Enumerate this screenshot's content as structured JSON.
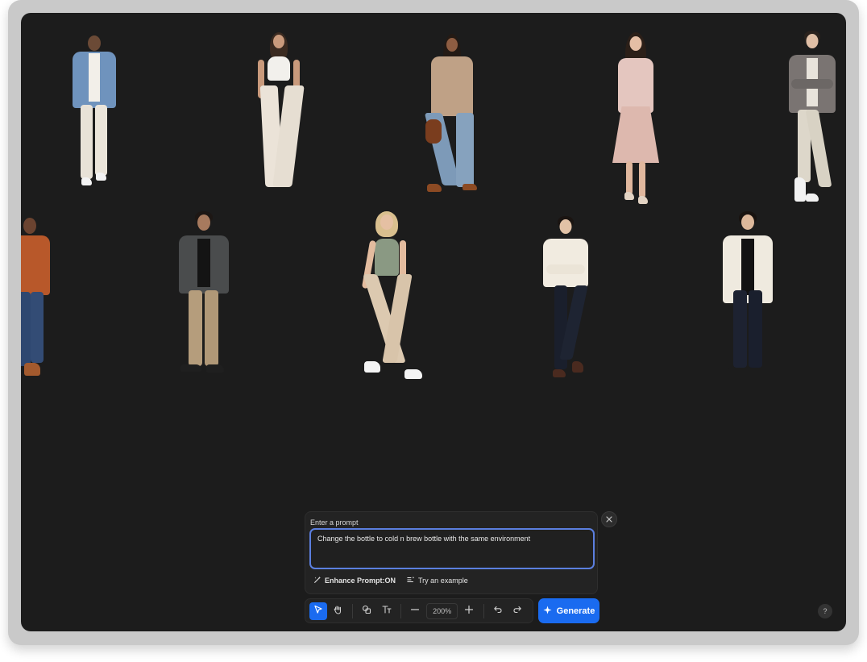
{
  "prompt": {
    "label": "Enter a prompt",
    "value": "Change the bottle to cold n brew bottle with the same environment",
    "enhance_label": "Enhance Prompt:ON",
    "example_label": "Try an example"
  },
  "toolbar": {
    "zoom": "200%",
    "generate_label": "Generate"
  },
  "help": {
    "label": "?"
  },
  "colors": {
    "canvas_bg": "#1c1c1c",
    "accent": "#1a6bf0",
    "focus_border": "#5b7fdf"
  },
  "canvas": {
    "items": [
      {
        "name": "model-man-denim-jacket"
      },
      {
        "name": "model-woman-white-wide-pants"
      },
      {
        "name": "model-woman-beige-coat-jeans"
      },
      {
        "name": "model-woman-pink-pleated-skirt"
      },
      {
        "name": "model-man-gray-jacket"
      },
      {
        "name": "model-woman-orange-jacket"
      },
      {
        "name": "model-man-bomber-khakis"
      },
      {
        "name": "model-woman-sage-tank"
      },
      {
        "name": "model-man-cream-sweater"
      },
      {
        "name": "model-man-cream-shirt"
      }
    ]
  }
}
